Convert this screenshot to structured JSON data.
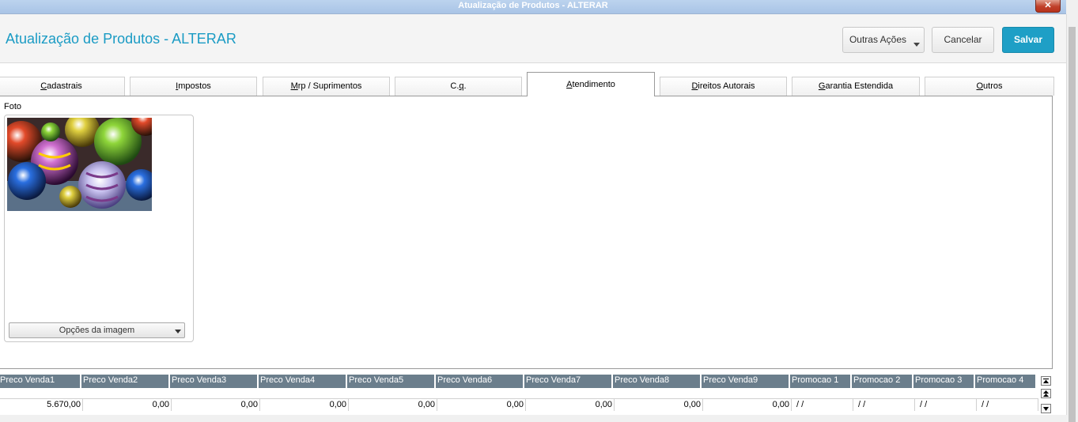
{
  "window": {
    "title": "Atualização de Produtos - ALTERAR",
    "close_label": "✕"
  },
  "header": {
    "title": "Atualização de Produtos - ALTERAR",
    "outras_acoes_label": "Outras Ações",
    "cancelar_label": "Cancelar",
    "salvar_label": "Salvar"
  },
  "tabs": [
    {
      "label": "Cadastrais",
      "underline": "C"
    },
    {
      "label": "Impostos",
      "underline": "I"
    },
    {
      "label": "Mrp / Suprimentos",
      "underline": "M"
    },
    {
      "label": "C.q.",
      "underline": "q"
    },
    {
      "label": "Atendimento",
      "underline": "A",
      "active": true
    },
    {
      "label": "Direitos Autorais",
      "underline": "D"
    },
    {
      "label": "Garantia Estendida",
      "underline": "G"
    },
    {
      "label": "Outros",
      "underline": "O"
    }
  ],
  "panel": {
    "foto_label": "Foto",
    "image_options_label": "Opções da imagem"
  },
  "grid": {
    "headers": [
      "Preco Venda1",
      "Preco Venda2",
      "Preco Venda3",
      "Preco Venda4",
      "Preco Venda5",
      "Preco Venda6",
      "Preco Venda7",
      "Preco Venda8",
      "Preco Venda9",
      "Promocao 1",
      "Promocao 2",
      "Promocao 3",
      "Promocao 4"
    ],
    "values": [
      "5.670,00",
      "0,00",
      "0,00",
      "0,00",
      "0,00",
      "0,00",
      "0,00",
      "0,00",
      "0,00",
      " /  /",
      " /  /",
      " /  /",
      " /  /"
    ]
  },
  "colors": {
    "accent": "#1a9bc4",
    "save_button": "#1e9fc6",
    "grid_header": "#6b7e8c"
  }
}
